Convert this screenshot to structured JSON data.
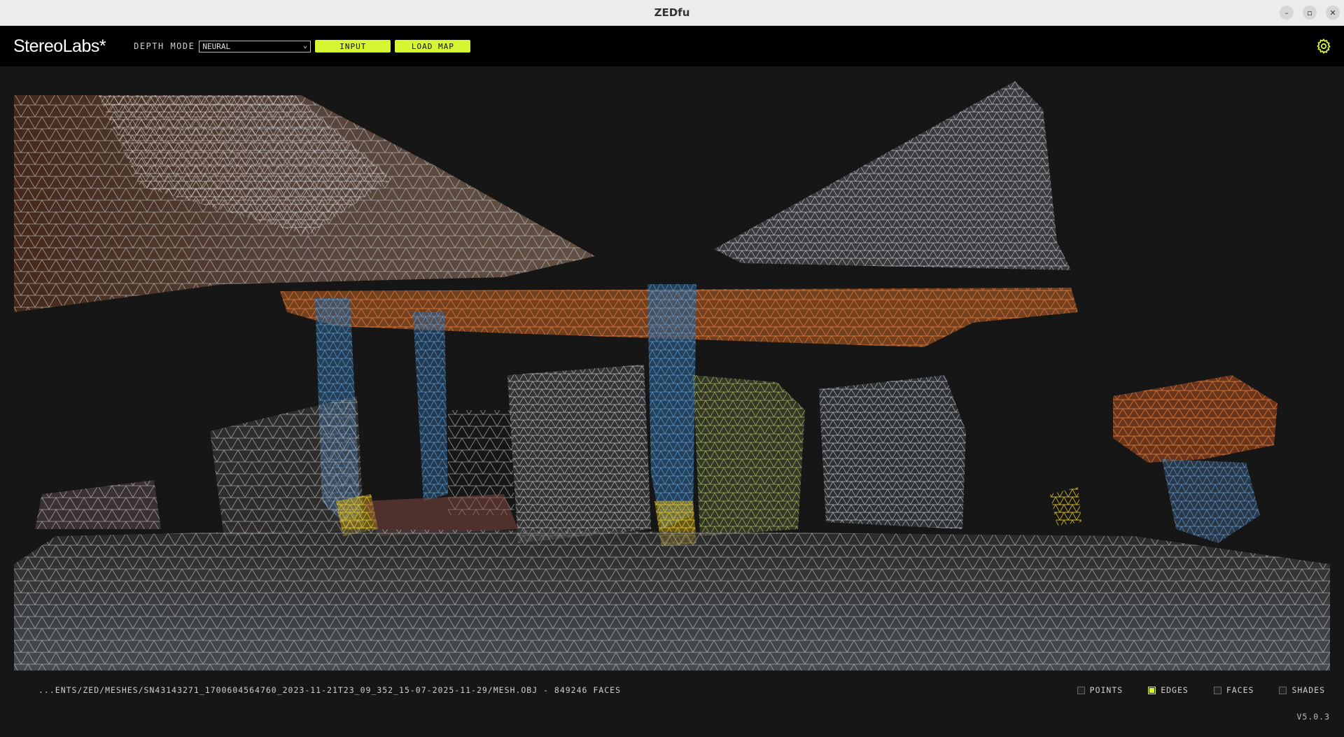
{
  "window": {
    "title": "ZEDfu"
  },
  "toolbar": {
    "brand": "StereoLabs*",
    "depth_mode_label": "DEPTH MODE",
    "depth_mode_value": "NEURAL",
    "input_label": "INPUT",
    "load_map_label": "LOAD MAP"
  },
  "status": {
    "file_path": "...ENTS/ZED/MESHES/SN43143271_1700604564760_2023-11-21T23_09_352_15-07-2025-11-29/MESH.OBJ - 849246 FACES",
    "version": "V5.0.3"
  },
  "render_options": [
    {
      "label": "POINTS",
      "checked": false
    },
    {
      "label": "EDGES",
      "checked": true
    },
    {
      "label": "FACES",
      "checked": false
    },
    {
      "label": "SHADES",
      "checked": false
    }
  ],
  "colors": {
    "accent": "#d6f532",
    "background": "#161616",
    "toolbar": "#000000"
  },
  "icons": {
    "settings": "gear-icon"
  }
}
